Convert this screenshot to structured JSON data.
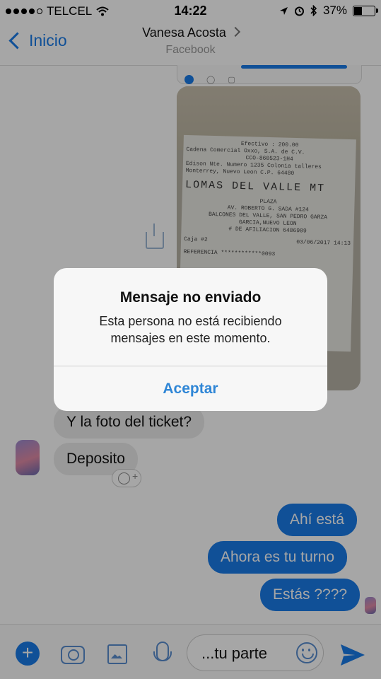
{
  "status_bar": {
    "carrier": "TELCEL",
    "time": "14:22",
    "battery": "37%",
    "battery_level": 0.37
  },
  "nav": {
    "back_label": "Inicio",
    "contact_name": "Vanesa Acosta",
    "contact_subtitle": "Facebook"
  },
  "receipt_image": {
    "lines": [
      "Efectivo : 200.00",
      "Cadena Comercial Oxxo, S.A. de C.V.",
      "CCO-860523-1H4",
      "Edison Nte. Numero 1235 Colonia talleres",
      "Monterrey, Nuevo Leon C.P. 64480",
      "LOMAS DEL VALLE MT",
      "PLAZA",
      "AV. ROBERTO G. SADA #124",
      "BALCONES DEL VALLE, SAN PEDRO GARZA",
      "GARCIA,NUEVO LEON",
      "# DE AFILIACION 6486989",
      "Caja #2",
      "03/06/2017 14:13",
      "REFERENCIA ************0093"
    ]
  },
  "messages": [
    {
      "text": "Y la foto del ticket?",
      "direction": "incoming"
    },
    {
      "text": "Deposito",
      "direction": "incoming"
    },
    {
      "text": "Ahí está",
      "direction": "outgoing"
    },
    {
      "text": "Ahora es tu turno",
      "direction": "outgoing"
    },
    {
      "text": "Estás ????",
      "direction": "outgoing"
    }
  ],
  "composer": {
    "input_value": "...tu parte"
  },
  "alert": {
    "title": "Mensaje no enviado",
    "message": "Esta persona no está recibiendo mensajes en este momento.",
    "button": "Aceptar"
  },
  "colors": {
    "accent": "#1a7be8",
    "incoming_bubble": "#ebebeb",
    "alert_button": "#2f86d6"
  },
  "icons": [
    "wifi-icon",
    "location-icon",
    "alarm-icon",
    "bluetooth-icon",
    "battery-icon",
    "back-chevron-icon",
    "share-icon",
    "react-emoji-icon",
    "plus-icon",
    "camera-icon",
    "image-icon",
    "microphone-icon",
    "emoji-icon",
    "send-icon"
  ]
}
